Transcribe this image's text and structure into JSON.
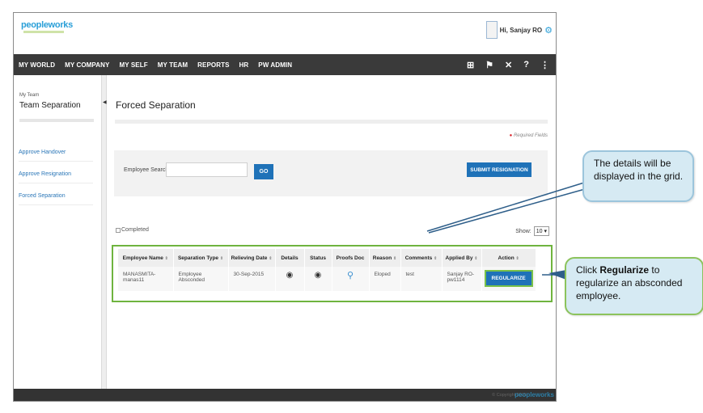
{
  "header": {
    "logo_text": "peopleworks",
    "greeting": "Hi, Sanjay RO"
  },
  "nav": {
    "items": [
      "MY WORLD",
      "MY COMPANY",
      "MY SELF",
      "MY TEAM",
      "REPORTS",
      "HR",
      "PW ADMIN"
    ],
    "icons": [
      "book-icon",
      "pin-icon",
      "tools-icon",
      "help-icon",
      "share-icon"
    ]
  },
  "sidebar": {
    "breadcrumb": "My Team",
    "title": "Team Separation",
    "links": [
      "Approve Handover",
      "Approve Resignation",
      "Forced Separation"
    ]
  },
  "main": {
    "page_title": "Forced Separation",
    "required_note": "Required Fields",
    "search_label": "Employee Search",
    "search_value": "",
    "go_label": "GO",
    "submit_label": "SUBMIT RESIGNATION",
    "completed_label": "Completed",
    "show_label": "Show:",
    "show_value": "10"
  },
  "table": {
    "columns": [
      "Employee Name",
      "Separation Type",
      "Relieving Date",
      "Details",
      "Status",
      "Proofs Doc",
      "Reason",
      "Comments",
      "Applied By",
      "Action"
    ],
    "rows": [
      {
        "employee_name": "MANASMITA-manas11",
        "separation_type": "Employee Absconded",
        "relieving_date": "30-Sep-2015",
        "reason": "Eloped",
        "comments": "test",
        "applied_by": "Sanjay RO-pw1114",
        "action_label": "REGULARIZE"
      }
    ]
  },
  "footer": {
    "copyright": "© Copyright 2015",
    "logo_text": "peopleworks"
  },
  "callouts": {
    "grid_note": "The details will be displayed in the grid.",
    "regularize_prefix": "Click ",
    "regularize_bold": "Regularize",
    "regularize_suffix": " to regularize an absconded employee."
  },
  "colors": {
    "nav_bg": "#3a3a3a",
    "button_blue": "#1f72b8",
    "highlight_green": "#6fb43f",
    "callout_bg": "#d6eaf3"
  }
}
